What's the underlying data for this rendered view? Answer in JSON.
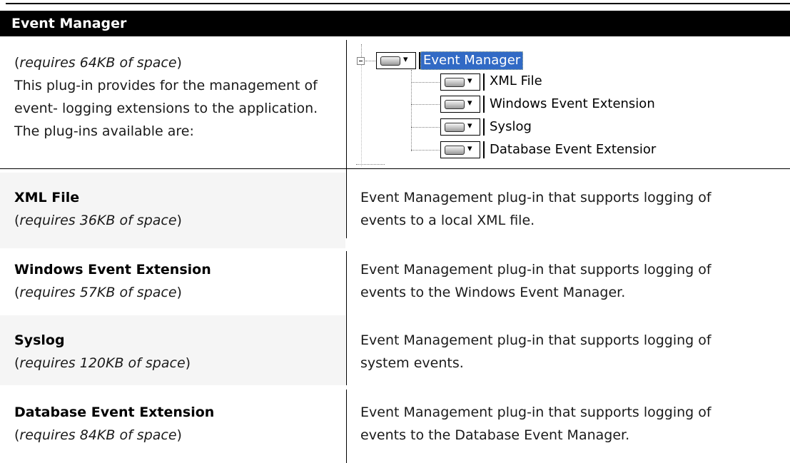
{
  "header": {
    "title": "Event Manager"
  },
  "intro": {
    "requires_prefix": "(",
    "requires_text": "requires 64KB of space",
    "requires_suffix": ")",
    "description": "This plug-in provides for the management of event- logging extensions to the application. The plug-ins available are:"
  },
  "tree": {
    "root": {
      "label": "Event Manager",
      "icon": "plugin-dropdown-icon",
      "selected": true
    },
    "children": [
      {
        "label": "XML File",
        "icon": "plugin-dropdown-icon"
      },
      {
        "label": "Windows Event Extension",
        "icon": "plugin-dropdown-icon"
      },
      {
        "label": "Syslog",
        "icon": "plugin-dropdown-icon"
      },
      {
        "label": "Database Event Extensior",
        "icon": "plugin-dropdown-icon"
      }
    ],
    "expander_icon": "collapse-minus-icon",
    "dropdown_glyph": "▾"
  },
  "plugins": [
    {
      "name": "XML File",
      "requires": "requires 36KB of space",
      "description": "Event Management plug-in that supports logging of events to a local XML file."
    },
    {
      "name": "Windows Event Extension",
      "requires": "requires 57KB of space",
      "description": "Event Management plug-in that supports logging of events to the Windows Event Manager."
    },
    {
      "name": "Syslog",
      "requires": "requires 120KB of space",
      "description": "Event Management plug-in that supports logging of system events."
    },
    {
      "name": "Database Event Extension",
      "requires": "requires 84KB of space",
      "description": "Event Management plug-in that supports logging of events to the Database Event Manager."
    }
  ]
}
